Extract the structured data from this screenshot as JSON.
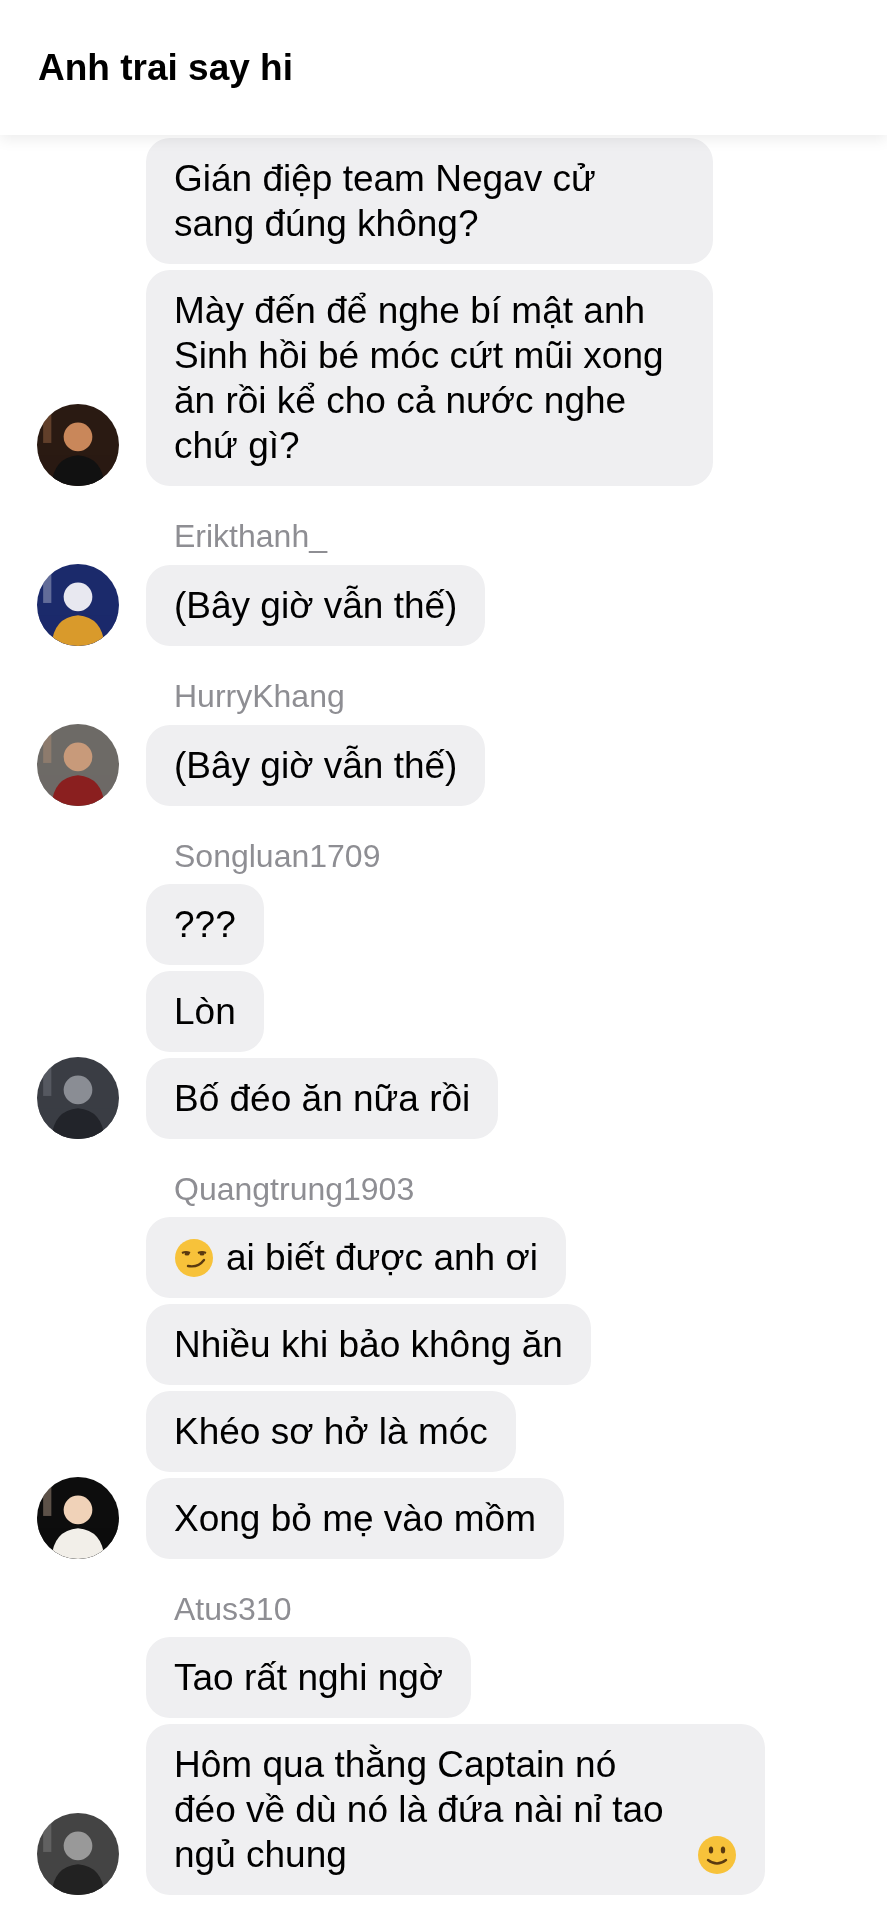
{
  "header": {
    "title": "Anh trai say hi"
  },
  "groups": [
    {
      "messages": [
        {
          "kind": "plain",
          "text": "Gián điệp team Negav cử sang đúng không?"
        },
        {
          "kind": "plain",
          "text": "Mày đến để nghe bí mật anh Sinh hồi bé móc cứt mũi xong ăn rồi kể cho cả nước nghe chứ gì?"
        }
      ]
    },
    {
      "sender": "Erikthanh_",
      "messages": [
        {
          "kind": "plain",
          "text": "(Bây giờ vẫn thế)"
        }
      ]
    },
    {
      "sender": "HurryKhang",
      "messages": [
        {
          "kind": "plain",
          "text": "(Bây giờ vẫn thế)"
        }
      ]
    },
    {
      "sender": "Songluan1709",
      "messages": [
        {
          "kind": "plain",
          "text": "???"
        },
        {
          "kind": "plain",
          "text": "Lòn"
        },
        {
          "kind": "plain",
          "text": "Bố đéo ăn nữa rồi"
        }
      ]
    },
    {
      "sender": "Quangtrung1903",
      "messages": [
        {
          "kind": "smirk",
          "text": "ai biết được anh ơi"
        },
        {
          "kind": "plain",
          "text": "Nhiều khi bảo không ăn"
        },
        {
          "kind": "plain",
          "text": "Khéo sơ hở là móc"
        },
        {
          "kind": "plain",
          "text": "Xong bỏ mẹ vào mồm"
        }
      ]
    },
    {
      "sender": "Atus310",
      "messages": [
        {
          "kind": "plain",
          "text": "Tao rất nghi ngờ"
        },
        {
          "kind": "smile",
          "text": "Hôm qua thằng Captain nó đéo về dù nó là đứa nài nỉ tao ngủ chung"
        }
      ]
    }
  ]
}
